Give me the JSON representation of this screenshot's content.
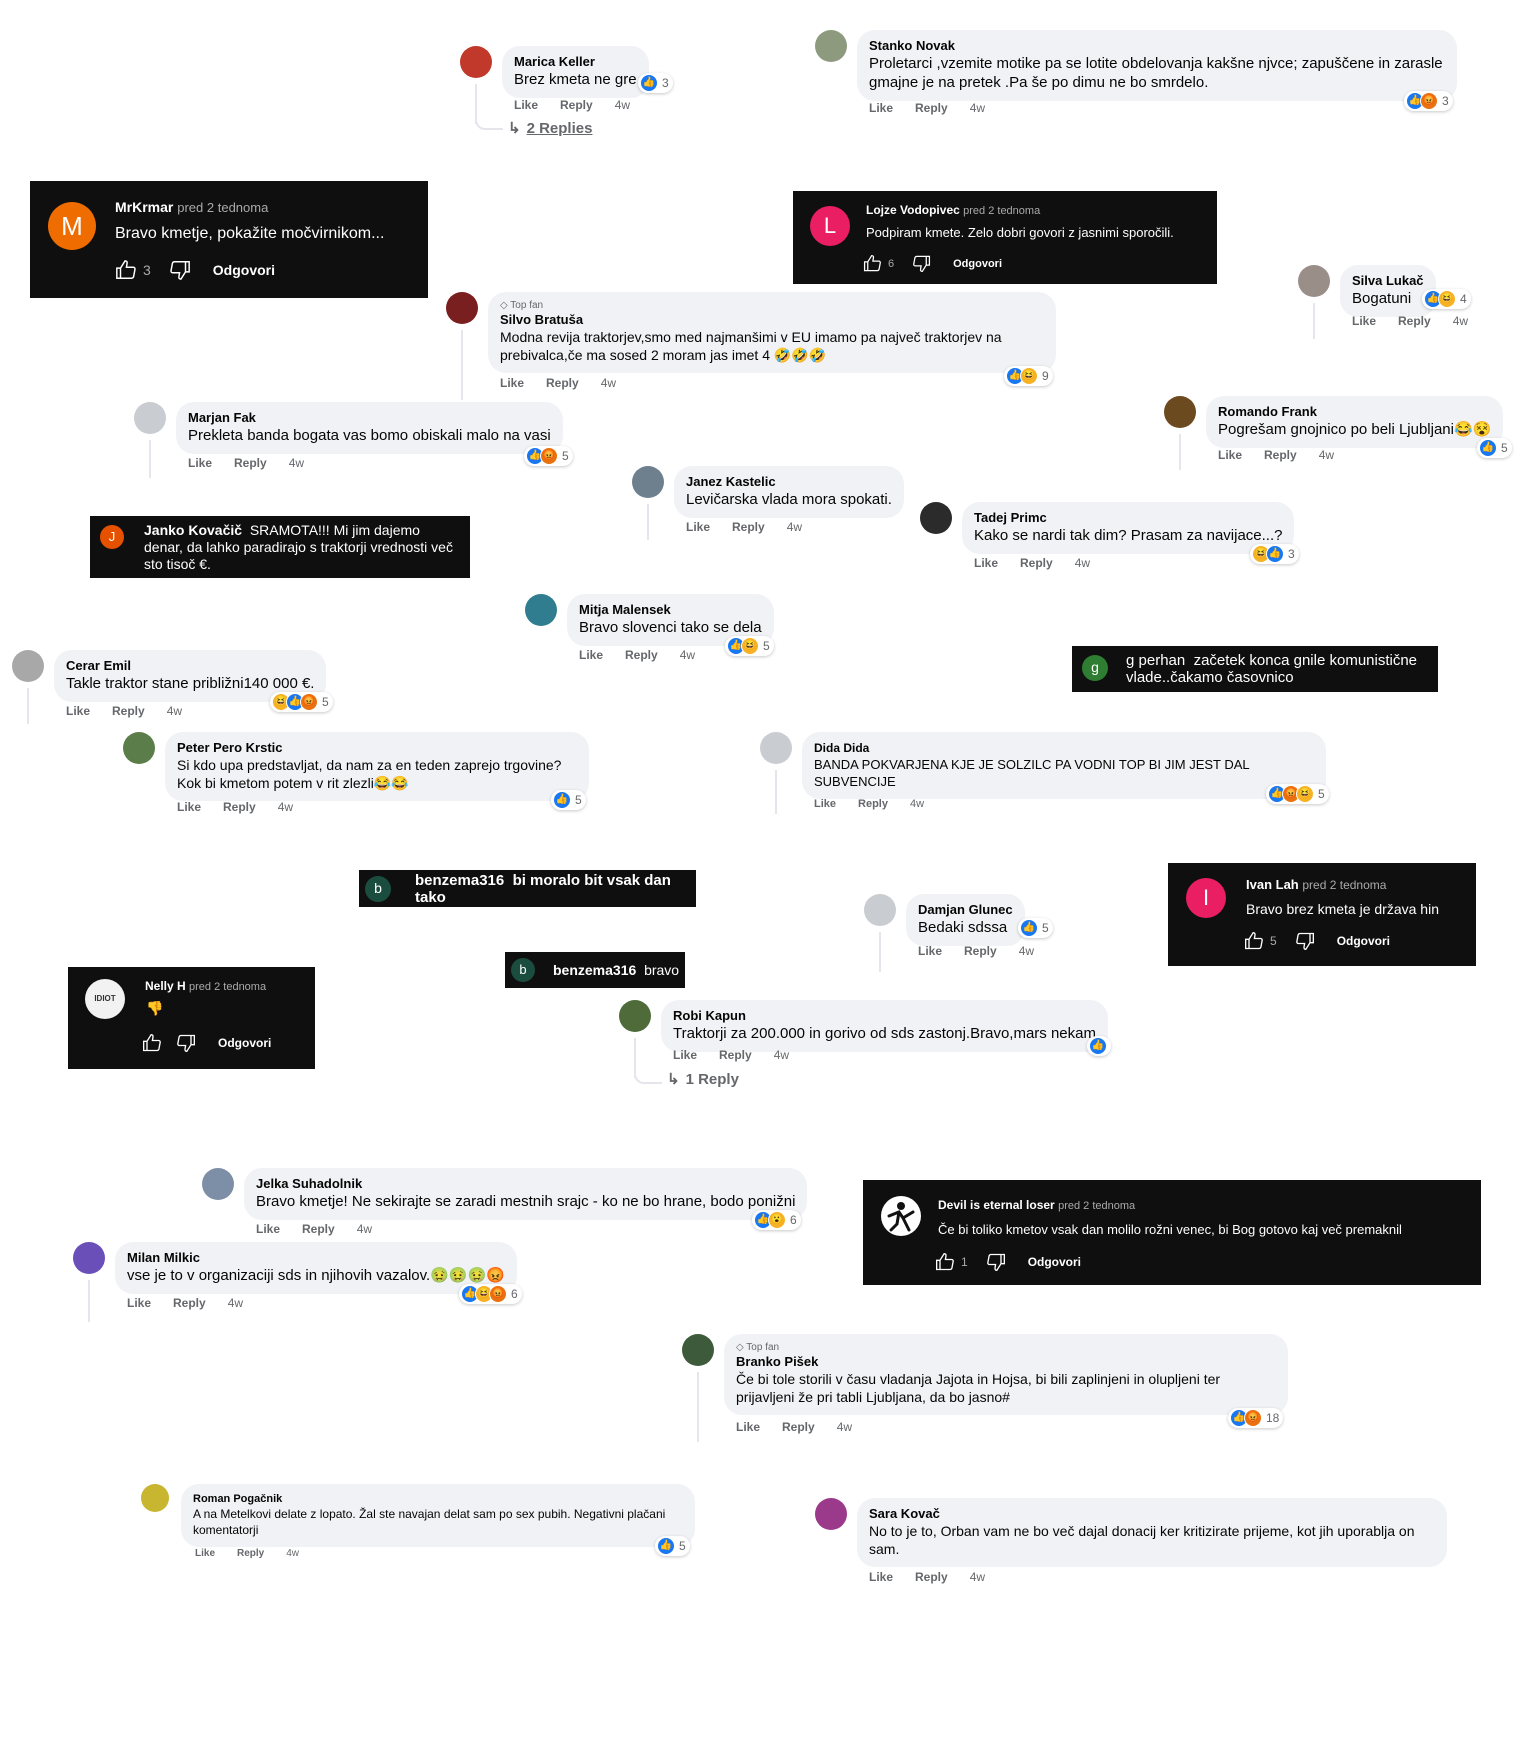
{
  "labels": {
    "like": "Like",
    "reply": "Reply",
    "yt_reply": "Odgovori",
    "top_fan": "Top fan"
  },
  "fb_comments": [
    {
      "id": "marica",
      "name": "Marica Keller",
      "text": "Brez kmeta ne gre",
      "time": "4w",
      "reactions": [
        "like"
      ],
      "count": "3",
      "replies": "2 Replies",
      "avatar_color": "#c0392b"
    },
    {
      "id": "stanko",
      "name": "Stanko Novak",
      "text": "Proletarci ,vzemite motike pa se lotite obdelovanja kakšne njvce; zapuščene in zarasle gmajne je na pretek .Pa še po dimu ne bo smrdelo.",
      "time": "4w",
      "reactions": [
        "like",
        "angry"
      ],
      "count": "3",
      "avatar_color": "#8d9a7d"
    },
    {
      "id": "silvo",
      "name": "Silvo Bratuša",
      "top_fan": true,
      "text": "Modna revija traktorjev,smo med najmanšimi v EU imamo pa največ traktorjev na prebivalca,če ma sosed 2 moram jas imet 4 🤣🤣🤣",
      "time": "4w",
      "reactions": [
        "like",
        "haha"
      ],
      "count": "9",
      "avatar_color": "#7a1f1f"
    },
    {
      "id": "silvalukac",
      "name": "Silva Lukač",
      "text": "Bogatuni",
      "time": "4w",
      "reactions": [
        "like",
        "haha"
      ],
      "count": "4",
      "avatar_color": "#9a8f88"
    },
    {
      "id": "marjan",
      "name": "Marjan Fak",
      "text": "Prekleta banda bogata vas bomo obiskali malo na vasi",
      "time": "4w",
      "reactions": [
        "like",
        "angry"
      ],
      "count": "5",
      "avatar_color": "#c9ccd1"
    },
    {
      "id": "romando",
      "name": "Romando Frank",
      "text": "Pogrešam gnojnico po beli Ljubljani😂😵",
      "time": "4w",
      "reactions": [
        "like"
      ],
      "count": "5",
      "avatar_color": "#6b4a1f"
    },
    {
      "id": "janez",
      "name": "Janez Kastelic",
      "text": "Levičarska vlada mora spokati.",
      "time": "4w",
      "reactions": [],
      "count": "",
      "avatar_color": "#6e7f8d"
    },
    {
      "id": "tadej",
      "name": "Tadej Primc",
      "text": "Kako se nardi tak dim? Prasam za navijace...?",
      "time": "4w",
      "reactions": [
        "haha",
        "like"
      ],
      "count": "3",
      "avatar_color": "#2b2b2b"
    },
    {
      "id": "mitja",
      "name": "Mitja Malensek",
      "text": "Bravo slovenci tako se dela",
      "time": "4w",
      "reactions": [
        "like",
        "haha"
      ],
      "count": "5",
      "avatar_color": "#2f7d8f"
    },
    {
      "id": "cerar",
      "name": "Cerar Emil",
      "text": "Takle traktor stane približni140 000 €.",
      "time": "4w",
      "reactions": [
        "haha",
        "like",
        "angry"
      ],
      "count": "5",
      "avatar_color": "#a8a8a8"
    },
    {
      "id": "peter",
      "name": "Peter Pero Krstic",
      "text": "Si kdo upa predstavljat, da nam za en teden zaprejo trgovine? Kok bi kmetom potem v rit zlezli😂😂",
      "time": "4w",
      "reactions": [
        "like"
      ],
      "count": "5",
      "avatar_color": "#5b7d4a"
    },
    {
      "id": "dida",
      "name": "Dida Dida",
      "text": "BANDA POKVARJENA KJE JE SOLZILC PA VODNI TOP BI JIM JEST DAL SUBVENCIJE",
      "time": "4w",
      "reactions": [
        "like",
        "angry",
        "haha"
      ],
      "count": "5",
      "avatar_color": "#c9ccd1"
    },
    {
      "id": "damjan",
      "name": "Damjan Glunec",
      "text": "Bedaki sdssa",
      "time": "4w",
      "reactions": [
        "like"
      ],
      "count": "5",
      "avatar_color": "#c9ccd1"
    },
    {
      "id": "robi",
      "name": "Robi Kapun",
      "text": "Traktorji za 200.000 in gorivo od sds zastonj.Bravo,mars nekam",
      "time": "4w",
      "reactions": [
        "like"
      ],
      "count": "",
      "replies": "1 Reply",
      "avatar_color": "#4f6b3a"
    },
    {
      "id": "jelka",
      "name": "Jelka Suhadolnik",
      "text": "Bravo kmetje! Ne sekirajte se zaradi mestnih srajc - ko ne bo hrane, bodo ponižni",
      "time": "4w",
      "reactions": [
        "like",
        "care"
      ],
      "count": "6",
      "avatar_color": "#7d8fa6"
    },
    {
      "id": "milan",
      "name": "Milan Milkic",
      "text": "vse je to v organizaciji sds in njihovih vazalov.🤢🤢🤢😡",
      "time": "4w",
      "reactions": [
        "like",
        "haha",
        "angry"
      ],
      "count": "6",
      "avatar_color": "#6a4fb8"
    },
    {
      "id": "branko",
      "name": "Branko Pišek",
      "top_fan": true,
      "text": "Če bi tole storili v času vladanja Jajota in Hojsa, bi bili zaplinjeni in olupljeni ter prijavljeni že pri tabli Ljubljana, da bo jasno#",
      "time": "4w",
      "reactions": [
        "like",
        "angry"
      ],
      "count": "18",
      "avatar_color": "#3d5a3a"
    },
    {
      "id": "roman",
      "name": "Roman Pogačnik",
      "text": "A na Metelkovi delate z lopato. Žal ste navajan delat sam po sex pubih. Negativni plačani komentatorji",
      "time": "4w",
      "reactions": [
        "like"
      ],
      "count": "5",
      "avatar_color": "#c8b630"
    },
    {
      "id": "sara",
      "name": "Sara Kovač",
      "text": "No to je to, Orban vam ne bo več dajal donacij ker kritizirate prijeme, kot jih uporablja on sam.",
      "time": "4w",
      "reactions": [],
      "count": "",
      "avatar_color": "#9b3a8a"
    }
  ],
  "yt_comments": [
    {
      "id": "mrkrmar",
      "initial": "M",
      "name": "MrKrmar",
      "when": "pred 2 tednoma",
      "text": "Bravo kmetje, pokažite močvirnikom...",
      "likes": "3",
      "avatar_color": "#ef6c00"
    },
    {
      "id": "lojze",
      "initial": "L",
      "name": "Lojze Vodopivec",
      "when": "pred 2 tednoma",
      "text": "Podpiram kmete. Zelo dobri govori z jasnimi sporočili.",
      "likes": "6",
      "avatar_color": "#e91e63"
    },
    {
      "id": "ivan",
      "initial": "I",
      "name": "Ivan Lah",
      "when": "pred 2 tednoma",
      "text": "Bravo brez kmeta je država hin",
      "likes": "5",
      "avatar_color": "#e91e63"
    },
    {
      "id": "nelly",
      "initial": "IDIOT",
      "name": "Nelly H",
      "when": "pred 2 tednoma",
      "text": "👎",
      "likes": "",
      "avatar_color": "#f2f2f2"
    },
    {
      "id": "devil",
      "initial": "",
      "name": "Devil is eternal loser",
      "when": "pred 2 tednoma",
      "text": "Če bi toliko kmetov vsak dan molilo rožni venec, bi Bog gotovo kaj več premaknil",
      "likes": "1",
      "avatar_color": "#ffffff"
    }
  ],
  "banners": [
    {
      "id": "janko",
      "initial": "J",
      "name": "Janko Kovačič",
      "text": "SRAMOTA!!! Mi jim dajemo denar, da lahko paradirajo s traktorji vrednosti več sto tisoč €.",
      "avatar_color": "#e65100"
    },
    {
      "id": "gperhan",
      "initial": "g",
      "name": "g perhan",
      "text": "začetek konca gnile komunistične vlade..čakamo časovnico",
      "avatar_color": "#2e7d32"
    },
    {
      "id": "benzema1",
      "initial": "b",
      "name": "benzema316",
      "text": "bi moralo bit vsak dan tako",
      "avatar_color": "#1b4d3e"
    },
    {
      "id": "benzema2",
      "initial": "b",
      "name": "benzema316",
      "text": "bravo",
      "avatar_color": "#1b4d3e"
    }
  ]
}
